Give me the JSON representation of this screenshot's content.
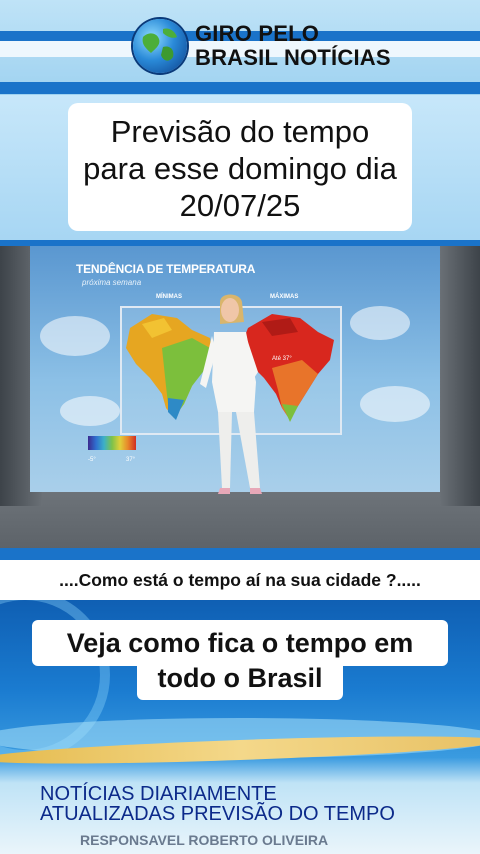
{
  "header": {
    "brand_line1": "GIRO PELO",
    "brand_line2": "BRASIL NOTÍCIAS",
    "logo_icon": "globe-icon"
  },
  "title": {
    "line1": "Previsão do tempo",
    "line2": "para esse domingo dia",
    "line3": "20/07/25"
  },
  "video": {
    "screen_title": "TENDÊNCIA DE TEMPERATURA",
    "screen_subtitle": "próxima semana",
    "label_min": "MÍNIMAS",
    "label_max": "MÁXIMAS",
    "scale_min": "-5°",
    "scale_max": "37°",
    "annotation_max": "Até 37°"
  },
  "question": "....Como está o tempo aí na sua cidade ?.....",
  "subtitle": {
    "line1": "Veja como fica o tempo em",
    "line2": "todo o Brasil"
  },
  "footer": {
    "line1": "NOTÍCIAS DIARIAMENTE",
    "line2": "ATUALIZADAS PREVISÃO DO TEMPO",
    "line3": "RESPONSAVEL ROBERTO OLIVEIRA"
  },
  "colors": {
    "accent_blue": "#1a73c9",
    "footer_text": "#0c2a8a"
  }
}
